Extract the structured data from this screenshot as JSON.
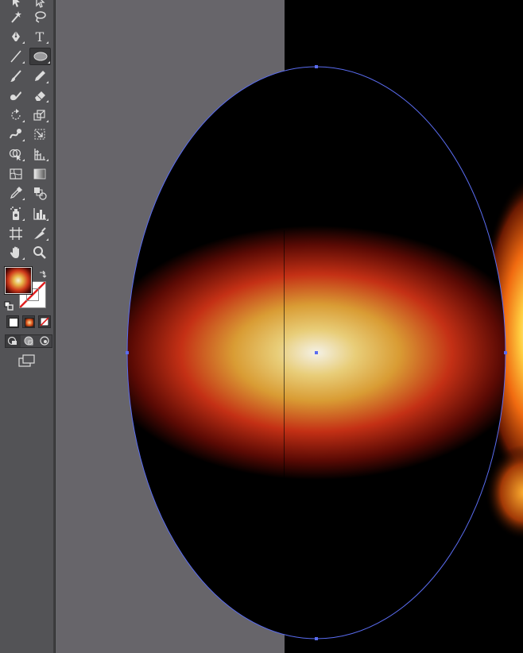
{
  "toolbar": {
    "tools": [
      {
        "id": "selection-tool",
        "icon": "arrow-icon"
      },
      {
        "id": "direct-selection-tool",
        "icon": "hollow-arrow-icon"
      },
      {
        "id": "magic-wand-tool",
        "icon": "magic-wand-icon"
      },
      {
        "id": "lasso-tool",
        "icon": "lasso-icon"
      },
      {
        "id": "pen-tool",
        "icon": "pen-icon"
      },
      {
        "id": "type-tool",
        "icon": "type-icon",
        "label": "T"
      },
      {
        "id": "line-tool",
        "icon": "line-icon"
      },
      {
        "id": "ellipse-tool",
        "icon": "ellipse-icon",
        "active": true
      },
      {
        "id": "paintbrush-tool",
        "icon": "brush-icon"
      },
      {
        "id": "pencil-tool",
        "icon": "pencil-icon"
      },
      {
        "id": "blob-brush-tool",
        "icon": "blob-brush-icon"
      },
      {
        "id": "eraser-tool",
        "icon": "eraser-icon"
      },
      {
        "id": "rotate-tool",
        "icon": "rotate-icon"
      },
      {
        "id": "scale-tool",
        "icon": "scale-icon"
      },
      {
        "id": "warp-tool",
        "icon": "warp-icon"
      },
      {
        "id": "free-transform-tool",
        "icon": "free-transform-icon"
      },
      {
        "id": "shape-builder-tool",
        "icon": "shape-builder-icon"
      },
      {
        "id": "perspective-grid-tool",
        "icon": "perspective-grid-icon"
      },
      {
        "id": "mesh-tool",
        "icon": "mesh-icon"
      },
      {
        "id": "gradient-tool",
        "icon": "gradient-icon"
      },
      {
        "id": "eyedropper-tool",
        "icon": "eyedropper-icon"
      },
      {
        "id": "blend-tool",
        "icon": "blend-icon"
      },
      {
        "id": "symbol-sprayer-tool",
        "icon": "symbol-sprayer-icon"
      },
      {
        "id": "column-graph-tool",
        "icon": "column-graph-icon"
      },
      {
        "id": "artboard-tool",
        "icon": "artboard-icon"
      },
      {
        "id": "slice-tool",
        "icon": "slice-icon"
      },
      {
        "id": "hand-tool",
        "icon": "hand-icon"
      },
      {
        "id": "zoom-tool",
        "icon": "zoom-icon"
      }
    ],
    "fill_stroke": {
      "fill": "radial-gradient",
      "stroke": "none"
    },
    "color_modes": [
      "color",
      "gradient",
      "none"
    ],
    "draw_modes": [
      "draw-normal",
      "draw-behind",
      "draw-inside"
    ],
    "screen_mode": "screen-mode-icon"
  },
  "colors": {
    "toolbar_bg": "#535356",
    "canvas_gray": "#67656a",
    "canvas_black": "#000000",
    "selection": "#5a6cf0",
    "gradient_stops": [
      "#f4f1e6",
      "#e2b440",
      "#c9331a",
      "#6e0c04",
      "#000000"
    ]
  },
  "selection": {
    "shape": "ellipse",
    "anchors": [
      "top",
      "left",
      "right",
      "bottom",
      "center"
    ]
  }
}
